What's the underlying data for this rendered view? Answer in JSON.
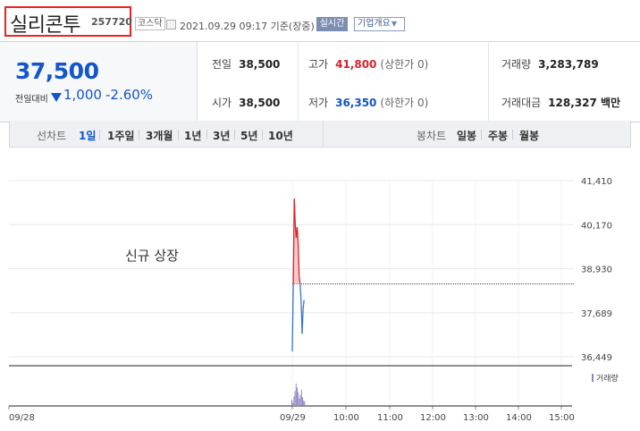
{
  "header": {
    "stock_name": "실리콘투",
    "stock_code": "257720",
    "market": "코스닥",
    "datetime": "2021.09.29 09:17 기준(장중)",
    "realtime_label": "실시간",
    "company_overview_label": "기업개요"
  },
  "price": {
    "current": "37,500",
    "diff_label": "전일대비",
    "diff_value": "1,000",
    "diff_rate": "-2.60%",
    "direction": "down",
    "color": "#1455c9"
  },
  "stats": {
    "prev_close_label": "전일",
    "prev_close": "38,500",
    "open_label": "시가",
    "open": "38,500",
    "high_label": "고가",
    "high": "41,800",
    "upper_limit": "(상한가 0)",
    "low_label": "저가",
    "low": "36,350",
    "lower_limit": "(하한가 0)",
    "volume_label": "거래량",
    "volume": "3,283,789",
    "amount_label": "거래대금",
    "amount": "128,327 백만"
  },
  "period_bar": {
    "line_chart_label": "선차트",
    "line_periods": [
      "1일",
      "1주일",
      "3개월",
      "1년",
      "3년",
      "5년",
      "10년"
    ],
    "active_period": "1일",
    "candle_chart_label": "봉차트",
    "candle_periods": [
      "일봉",
      "주봉",
      "월봉"
    ]
  },
  "chart_data": {
    "type": "line",
    "annotation": "신규 상장",
    "y_ticks": [
      "41,410",
      "40,170",
      "38,930",
      "37,689",
      "36,449"
    ],
    "ylim": [
      36449,
      41410
    ],
    "x_ticks": [
      "09/28",
      "09/29",
      "10:00",
      "11:00",
      "12:00",
      "13:00",
      "14:00",
      "15:00"
    ],
    "prev_close": 38500,
    "series": [
      {
        "values": [
          {
            "t": "09:00",
            "price": 36600
          },
          {
            "t": "09:00",
            "price": 38500
          },
          {
            "t": "09:01",
            "price": 40900
          },
          {
            "t": "09:02",
            "price": 40200
          },
          {
            "t": "09:03",
            "price": 39800
          },
          {
            "t": "09:05",
            "price": 40100
          },
          {
            "t": "09:07",
            "price": 39600
          },
          {
            "t": "09:09",
            "price": 38700
          },
          {
            "t": "09:11",
            "price": 38500
          },
          {
            "t": "09:13",
            "price": 38000
          },
          {
            "t": "09:15",
            "price": 37100
          },
          {
            "t": "09:16",
            "price": 37800
          },
          {
            "t": "09:17",
            "price": 38050
          }
        ]
      }
    ],
    "volume_label": "거래량",
    "volume_bars": [
      9,
      5,
      14,
      22,
      33,
      27,
      20,
      11,
      16,
      24,
      13,
      8,
      7
    ],
    "colors": {
      "up": "#e0242a",
      "down": "#3a74c9",
      "up_fill": "#f7c9cc",
      "volume": "#8f86c5"
    }
  }
}
